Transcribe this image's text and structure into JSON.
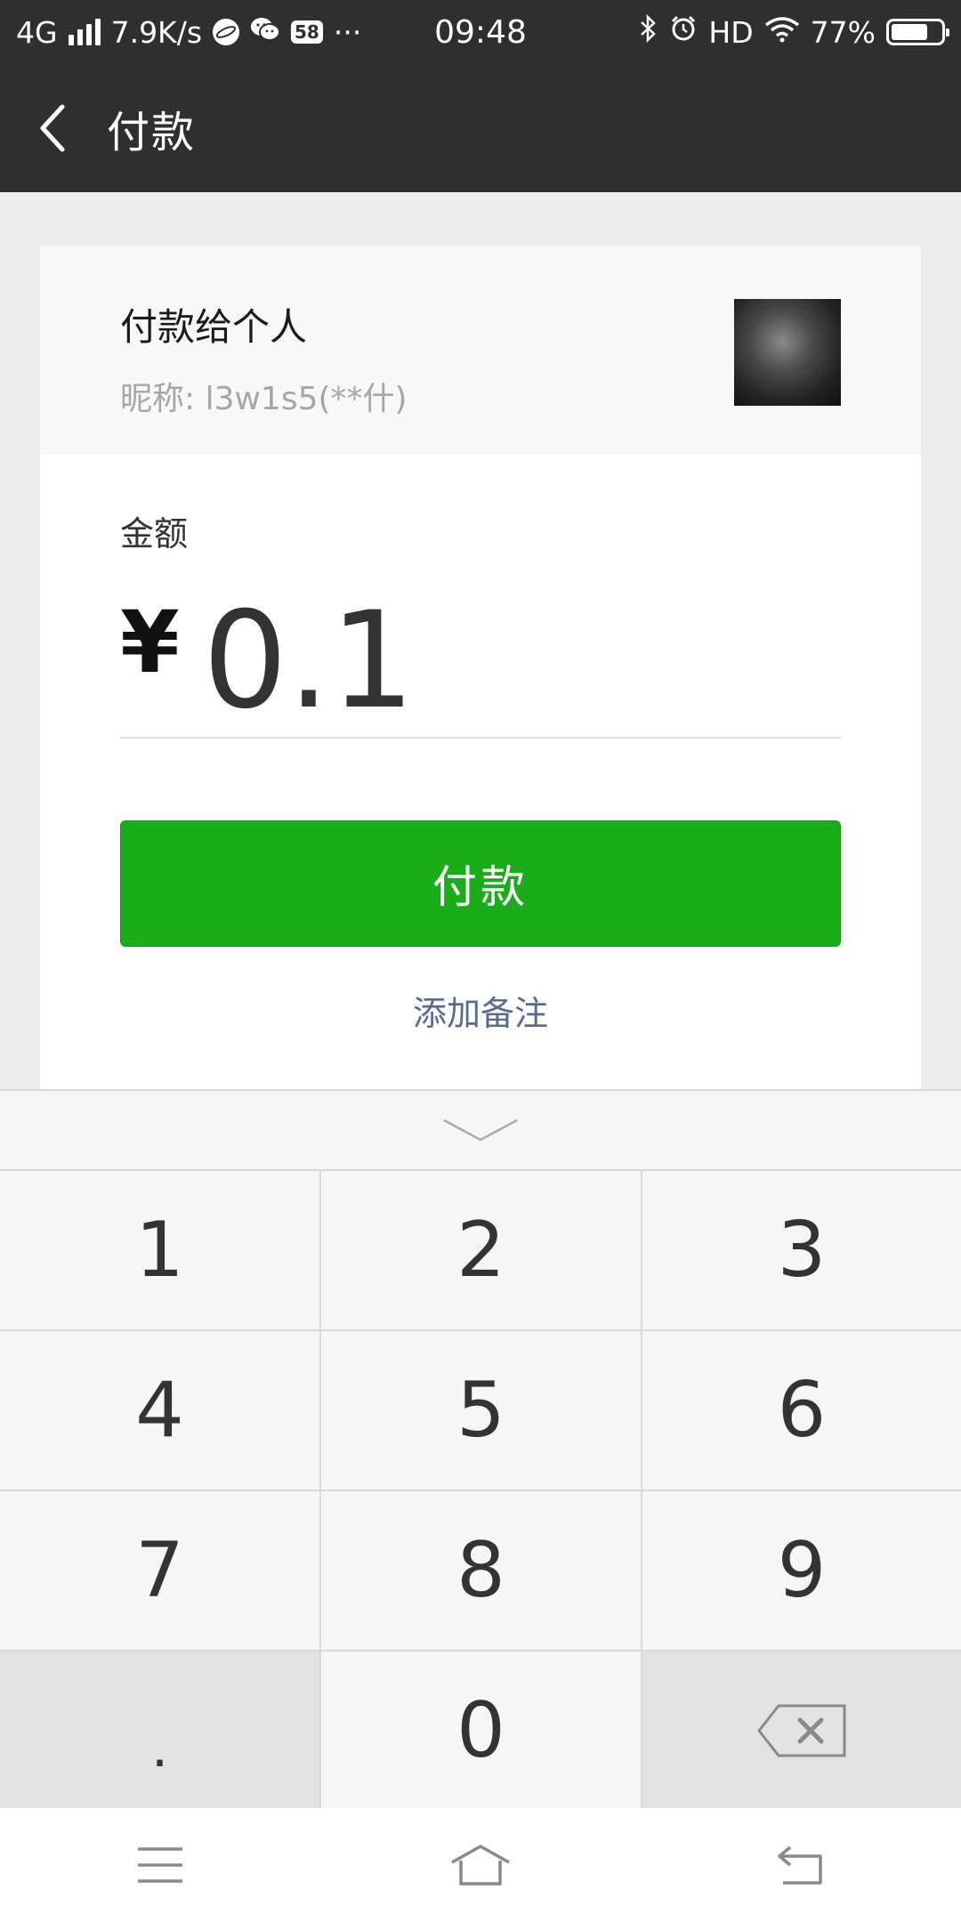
{
  "status_bar": {
    "network": "4G",
    "speed": "7.9K/s",
    "badge": "58",
    "more": "···",
    "time": "09:48",
    "hd": "HD",
    "battery": "77%",
    "battery_level": 0.77
  },
  "nav": {
    "title": "付款",
    "back_icon": "chevron-left-icon"
  },
  "payee": {
    "title": "付款给个人",
    "nickname": "昵称: l3w1s5(**什)"
  },
  "amount": {
    "label": "金额",
    "currency": "¥",
    "value": "0.1"
  },
  "pay_button": "付款",
  "remark_link": "添加备注",
  "keypad": {
    "collapse_icon": "chevron-down-icon",
    "keys": [
      "1",
      "2",
      "3",
      "4",
      "5",
      "6",
      "7",
      "8",
      "9",
      ".",
      "0"
    ],
    "delete_icon": "backspace-icon"
  },
  "system_nav": {
    "menu_icon": "menu-icon",
    "home_icon": "home-icon",
    "back_icon": "back-arrow-icon"
  },
  "colors": {
    "header": "#2f2f2f",
    "primary_button": "#1aad19",
    "link": "#576b95"
  }
}
